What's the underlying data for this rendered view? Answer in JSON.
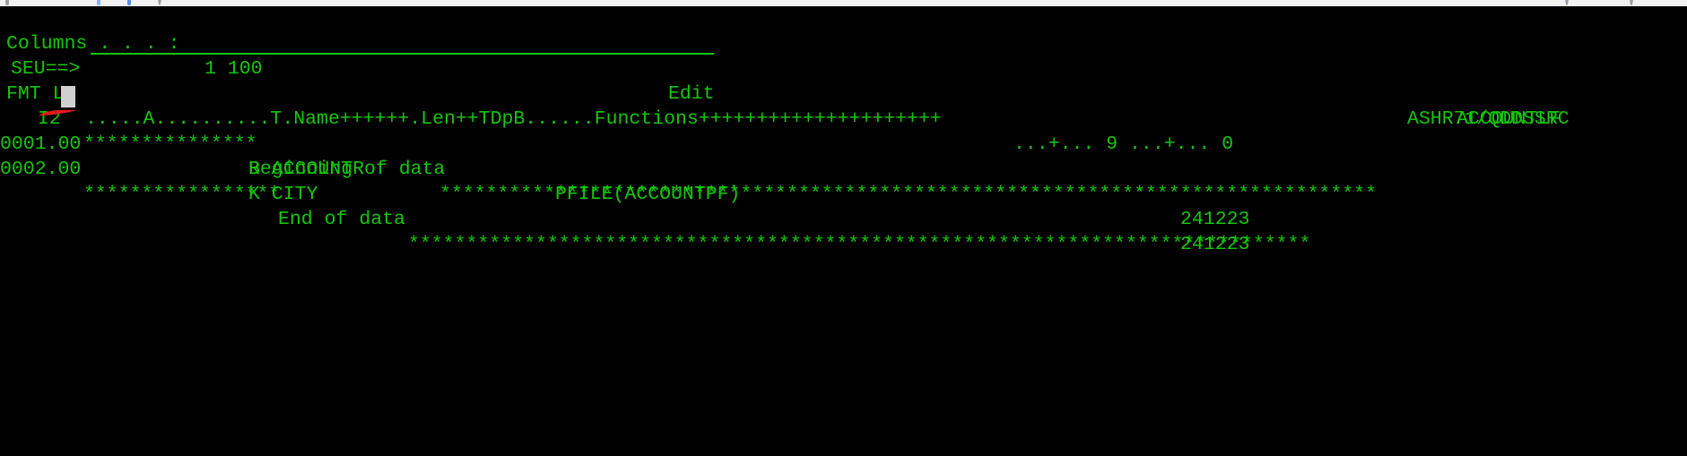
{
  "meta": {
    "screen_background": "#000000",
    "text_color": "#16c60c",
    "cursor_color": "#d0d0d0",
    "annotation_color": "#e01b1b"
  },
  "browser_chrome": {
    "visible_fragment": "toolbar icons partially cut off at top of screen",
    "icons": [
      "window-icon",
      "red-app-icon",
      "dash-icon",
      "page-icon",
      "blue-folder-icon",
      "circle-icon"
    ],
    "right_icons": [
      "star-icon",
      "puzzle-icon",
      "profile-icon",
      "menu-icon"
    ]
  },
  "header": {
    "columns_label": "Columns . . . :",
    "columns_value": "1 100",
    "title": "Edit",
    "library_member": "ASHR71/QDDSSRC"
  },
  "command": {
    "prompt": "SEU==>",
    "value": "",
    "placeholder": "",
    "member_name": "ACCOUNTLF"
  },
  "format_line": {
    "label": "FMT LF",
    "ruler": ".....A..........T.Name++++++.Len++TDpB......Functions+++++++++++++++++++++",
    "ruler_tail": "...+... 9 ...+... 0"
  },
  "editor": {
    "top_marker": {
      "sequence": "I2",
      "cursor": " ",
      "stars_left": "***************",
      "text": "Beginning of data",
      "stars_right": "*********************************************************************************"
    },
    "lines": [
      {
        "seq": "0001.00",
        "source": "R ACCOUNTR",
        "keyword": "PFILE(ACCOUNTPF)",
        "date": "241223"
      },
      {
        "seq": "0002.00",
        "source": "K CITY",
        "keyword": "",
        "date": "241223"
      }
    ],
    "bottom_marker": {
      "stars_left": "*****************",
      "text": "End of data",
      "stars_right": "******************************************************************************"
    }
  },
  "annotation": {
    "shape": "red-underline-stroke",
    "target": "I2 sequence field"
  }
}
